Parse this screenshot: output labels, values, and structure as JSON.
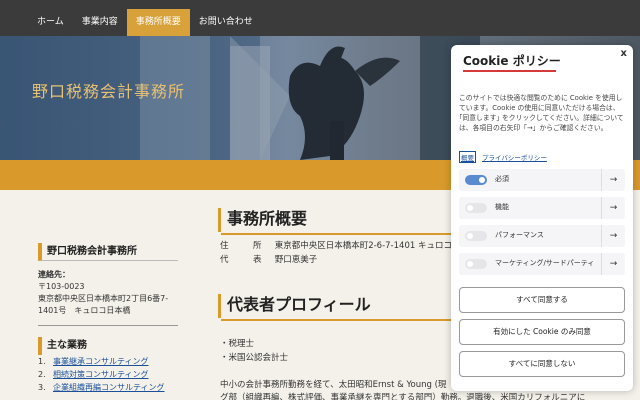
{
  "nav": {
    "items": [
      "ホーム",
      "事業内容",
      "事務所概要",
      "お問い合わせ"
    ],
    "active_index": 2
  },
  "hero": {
    "title": "野口税務会計事務所"
  },
  "sidebar": {
    "office_heading": "野口税務会計事務所",
    "contact_label": "連絡先：",
    "postal": "〒103-0023",
    "address_line1": "東京都中央区日本橋本町2丁目6番7-",
    "address_line2": "1401号　キュロコ日本橋",
    "business_heading": "主な業務",
    "business_items": [
      {
        "num": "1.",
        "label": "事業継承コンサルティング"
      },
      {
        "num": "2.",
        "label": "相続対策コンサルティング"
      },
      {
        "num": "3.",
        "label": "企業組織再編コンサルティング"
      }
    ]
  },
  "main": {
    "section1_title": "事務所概要",
    "address_key": "住　所",
    "address_value": "東京都中央区日本橋本町2-6-7-1401 キュロコ",
    "rep_key": "代　表",
    "rep_value": "野口恵美子",
    "section2_title": "代表者プロフィール",
    "profile_items": [
      "・税理士",
      "・米国公認会計士"
    ],
    "career_line1": "中小の会計事務所勤務を経て、太田昭和Ernst & Young (現",
    "career_line2": "グ部（組織再編、株式評価、事業承継を専門とする部門）勤務。退職後、米国カリフォルニアに"
  },
  "cookie": {
    "close": "x",
    "title": "Cookie ポリシー",
    "description": "このサイトでは快適な閲覧のために Cookie を使用しています。Cookie の使用に同意いただける場合は、｢同意します｣ をクリックしてください。詳細については、各項目の右矢印「→」からご確認ください。",
    "link_overview": "概要",
    "link_privacy": "プライバシーポリシー",
    "categories": [
      {
        "label": "必須",
        "enabled": true
      },
      {
        "label": "機能",
        "enabled": false
      },
      {
        "label": "パフォーマンス",
        "enabled": false
      },
      {
        "label": "マーケティング/サードパーティ",
        "enabled": false
      }
    ],
    "arrow": "→",
    "btn_accept_all": "すべて同意する",
    "btn_accept_selected": "有効にした Cookie のみ同意",
    "btn_reject_all": "すべてに同意しない"
  }
}
